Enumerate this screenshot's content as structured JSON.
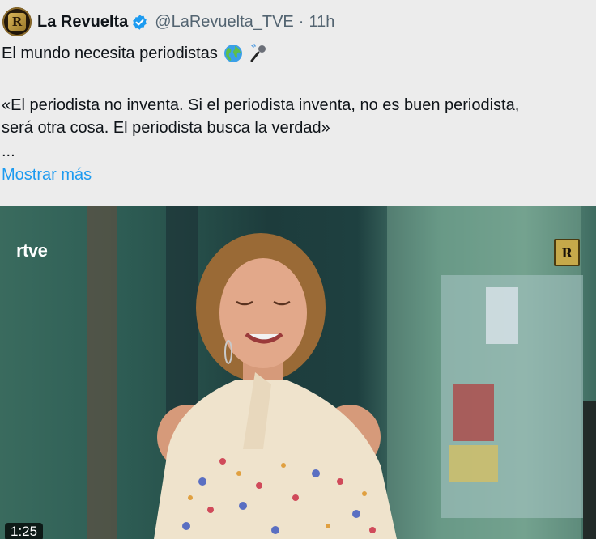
{
  "post": {
    "author_name": "La Revuelta",
    "author_handle": "@LaRevuelta_TVE",
    "separator": "·",
    "time": "11h",
    "avatar_letter": "R",
    "text_line1": "El mundo necesita periodistas",
    "text_line2": "«El periodista no inventa. Si el periodista inventa, no es buen periodista,",
    "text_line3": "será otra cosa. El periodista busca la verdad»",
    "text_line4": "...",
    "show_more": "Mostrar más",
    "emojis": [
      "globe-icon",
      "microphone-icon"
    ]
  },
  "media": {
    "channel_logo": "rtve",
    "corner_logo_letter": "R",
    "duration": "1:25"
  },
  "colors": {
    "link": "#1d9bf0",
    "verified": "#1d9bf0",
    "secondary_text": "#536471"
  }
}
